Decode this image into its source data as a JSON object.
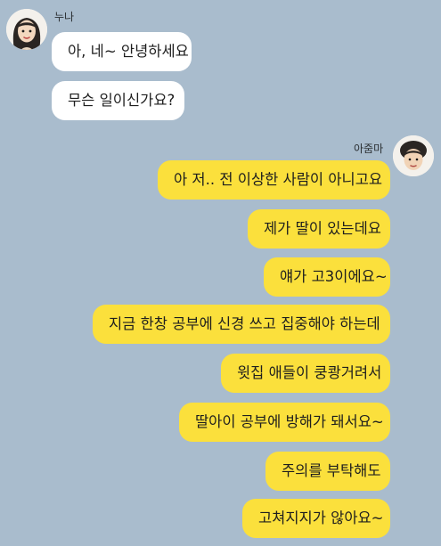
{
  "background_color": "#a9bccd",
  "incoming_bubble_color": "#ffffff",
  "outgoing_bubble_color": "#fbe03c",
  "contact_left": {
    "name": "누나",
    "avatar_icon": "woman-long-hair-avatar-icon"
  },
  "contact_right": {
    "name": "아줌마",
    "avatar_icon": "woman-short-curly-hair-avatar-icon"
  },
  "messages_left": [
    "아, 네~ 안녕하세요",
    "무슨 일이신가요?"
  ],
  "messages_right": [
    "아 저.. 전 이상한 사람이 아니고요",
    "제가 딸이 있는데요",
    "얘가 고3이에요~",
    "지금 한창 공부에 신경 쓰고 집중해야 하는데",
    "윗집 애들이 쿵쾅거려서",
    "딸아이 공부에 방해가 돼서요~",
    "주의를 부탁해도",
    "고쳐지지가 않아요~"
  ]
}
